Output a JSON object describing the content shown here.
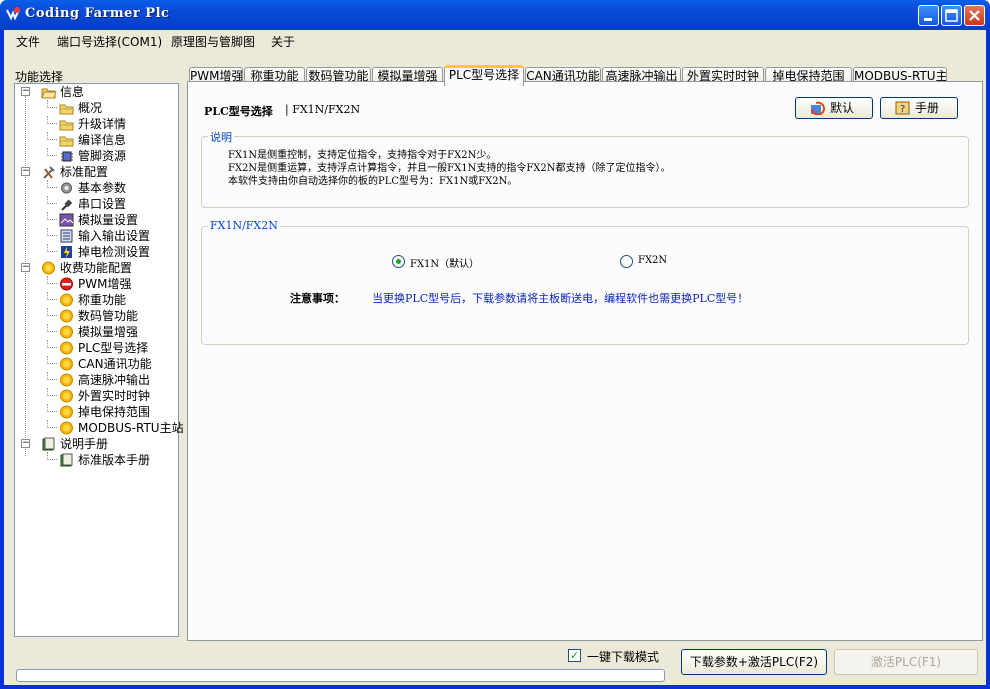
{
  "window": {
    "title": "Coding Farmer Plc"
  },
  "menu": [
    "文件",
    "端口号选择(COM1)",
    "原理图与管脚图",
    "关于"
  ],
  "sidebar": {
    "title": "功能选择",
    "items": [
      {
        "label": "信息",
        "icon": "folder-open-icon",
        "expander": "⊟"
      },
      {
        "label": "概况",
        "icon": "folder-icon"
      },
      {
        "label": "升级详情",
        "icon": "folder-icon"
      },
      {
        "label": "编译信息",
        "icon": "folder-icon"
      },
      {
        "label": "管脚资源",
        "icon": "chip-icon"
      },
      {
        "label": "标准配置",
        "icon": "tools-icon",
        "expander": "⊟"
      },
      {
        "label": "基本参数",
        "icon": "gear-icon"
      },
      {
        "label": "串口设置",
        "icon": "plug-icon"
      },
      {
        "label": "模拟量设置",
        "icon": "image-icon"
      },
      {
        "label": "输入输出设置",
        "icon": "io-icon"
      },
      {
        "label": "掉电检测设置",
        "icon": "power-icon"
      },
      {
        "label": "收费功能配置",
        "icon": "coin-icon",
        "expander": "⊟"
      },
      {
        "label": "PWM增强",
        "icon": "no-entry-icon"
      },
      {
        "label": "称重功能",
        "icon": "coin-icon"
      },
      {
        "label": "数码管功能",
        "icon": "coin-icon"
      },
      {
        "label": "模拟量增强",
        "icon": "coin-icon"
      },
      {
        "label": "PLC型号选择",
        "icon": "coin-icon"
      },
      {
        "label": "CAN通讯功能",
        "icon": "coin-icon"
      },
      {
        "label": "高速脉冲输出",
        "icon": "coin-icon"
      },
      {
        "label": "外置实时时钟",
        "icon": "coin-icon"
      },
      {
        "label": "掉电保持范围",
        "icon": "coin-icon"
      },
      {
        "label": "MODBUS-RTU主站",
        "icon": "coin-icon"
      },
      {
        "label": "说明手册",
        "icon": "book-icon",
        "expander": "⊟"
      },
      {
        "label": "标准版本手册",
        "icon": "book-icon"
      }
    ]
  },
  "tabs": [
    "PWM增强",
    "称重功能",
    "数码管功能",
    "模拟量增强",
    "PLC型号选择",
    "CAN通讯功能",
    "高速脉冲输出",
    "外置实时时钟",
    "掉电保持范围",
    "MODBUS-RTU主站"
  ],
  "active_tab": "PLC型号选择",
  "page": {
    "header_title": "PLC型号选择",
    "header_sub": "| FX1N/FX2N",
    "default_button": "默认",
    "manual_button": "手册",
    "desc_group_title": "说明",
    "desc_lines": [
      "FX1N是侧重控制，支持定位指令，支持指令对于FX2N少。",
      "FX2N是侧重运算，支持浮点计算指令，并且一般FX1N支持的指令FX2N都支持（除了定位指令）。",
      "本软件支持由你自动选择你的板的PLC型号为：FX1N或FX2N。"
    ],
    "model_group_title": "FX1N/FX2N",
    "radio_fx1n": "FX1N（默认）",
    "radio_fx2n": "FX2N",
    "selected": "FX1N",
    "note_label": "注意事项：",
    "note_text": "当更换PLC型号后，下载参数请将主板断送电，编程软件也需更换PLC型号！"
  },
  "footer": {
    "one_key_label": "一键下载模式",
    "one_key_checked": true,
    "download_button": "下载参数+激活PLC(F2)",
    "activate_button": "激活PLC(F1)"
  },
  "colors": {
    "titlebar": "#0a4ad8",
    "accent_tab": "#ffc83c",
    "note_text": "#0a25b8",
    "group_title": "#0046d5"
  }
}
